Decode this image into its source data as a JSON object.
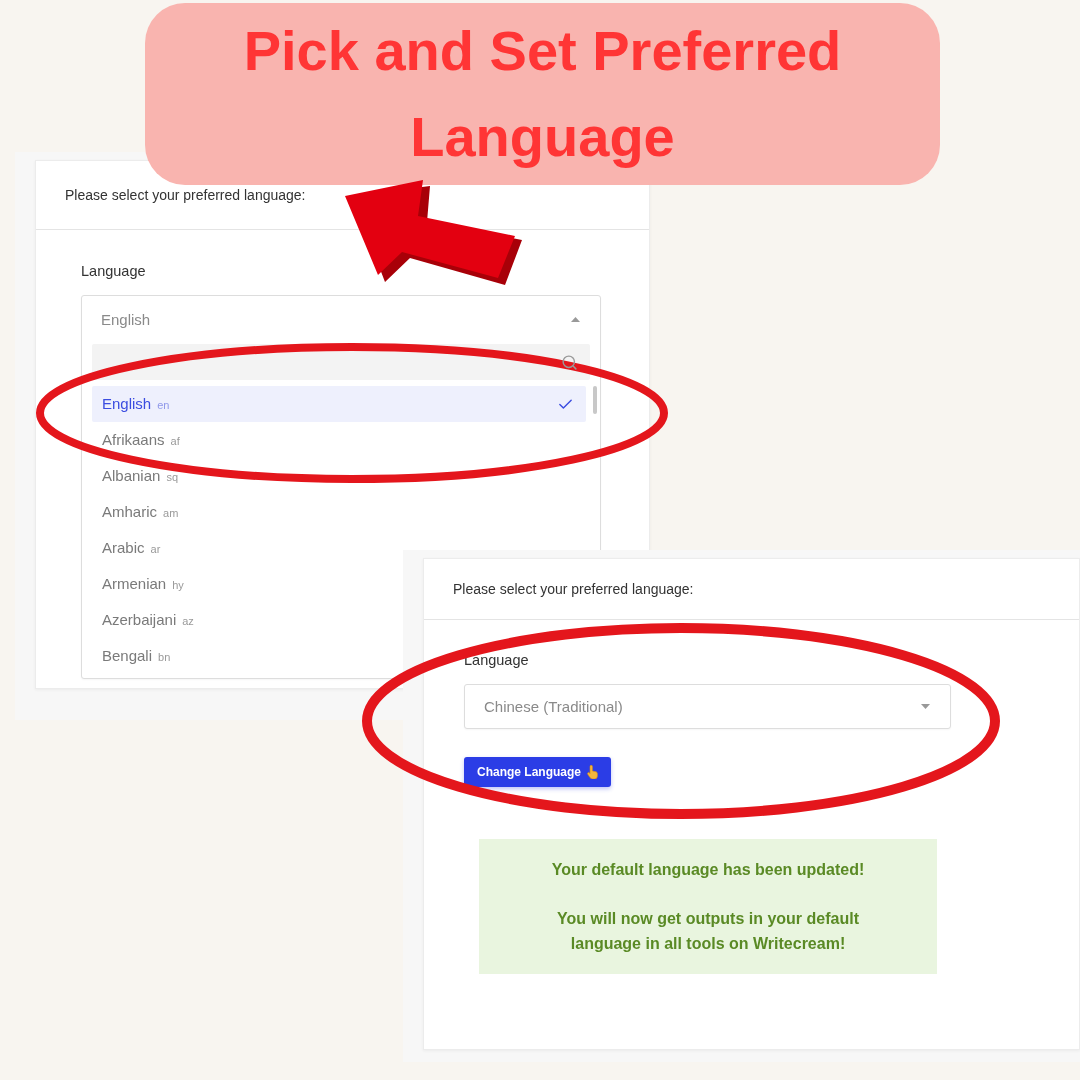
{
  "banner": {
    "title": "Pick and Set Preferred Language"
  },
  "left_panel": {
    "heading": "Please select your preferred language:",
    "field_label": "Language",
    "select": {
      "value": "English",
      "open": true
    },
    "options": [
      {
        "name": "English",
        "code": "en",
        "selected": true
      },
      {
        "name": "Afrikaans",
        "code": "af",
        "selected": false
      },
      {
        "name": "Albanian",
        "code": "sq",
        "selected": false
      },
      {
        "name": "Amharic",
        "code": "am",
        "selected": false
      },
      {
        "name": "Arabic",
        "code": "ar",
        "selected": false
      },
      {
        "name": "Armenian",
        "code": "hy",
        "selected": false
      },
      {
        "name": "Azerbaijani",
        "code": "az",
        "selected": false
      },
      {
        "name": "Bengali",
        "code": "bn",
        "selected": false
      }
    ]
  },
  "right_panel": {
    "heading": "Please select your preferred language:",
    "field_label": "Language",
    "select": {
      "value": "Chinese (Traditional)",
      "open": false
    },
    "button": "Change Language",
    "message": [
      "Your default language has been updated!",
      "You will now get outputs in your default language in all tools on Writecream!"
    ]
  }
}
